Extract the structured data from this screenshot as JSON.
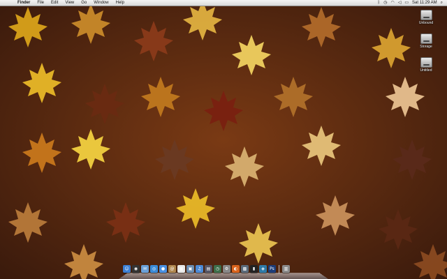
{
  "menubar": {
    "app_name": "Finder",
    "menus": [
      "File",
      "Edit",
      "View",
      "Go",
      "Window",
      "Help"
    ],
    "clock": "Sat 11:29 AM",
    "status_icons": [
      "bluetooth-icon",
      "time-machine-icon",
      "wifi-icon",
      "volume-icon",
      "battery-icon",
      "spotlight-icon"
    ]
  },
  "desktop": {
    "drives": [
      "Unbound",
      "Storage",
      "Untitled"
    ]
  },
  "dock": {
    "apps": [
      {
        "name": "finder-icon",
        "glyph": "☺",
        "color": "#3b7fd4"
      },
      {
        "name": "dashboard-icon",
        "glyph": "◉",
        "color": "#333"
      },
      {
        "name": "mail-icon",
        "glyph": "✉",
        "color": "#6aa0d8"
      },
      {
        "name": "safari-icon",
        "glyph": "◎",
        "color": "#3a8bd8"
      },
      {
        "name": "ichat-icon",
        "glyph": "●",
        "color": "#4a90e2"
      },
      {
        "name": "address-book-icon",
        "glyph": "@",
        "color": "#b08850"
      },
      {
        "name": "ical-icon",
        "glyph": "▦",
        "color": "#e8e8e8"
      },
      {
        "name": "preview-icon",
        "glyph": "▣",
        "color": "#6c8db0"
      },
      {
        "name": "itunes-icon",
        "glyph": "♫",
        "color": "#4c8ad6"
      },
      {
        "name": "spaces-icon",
        "glyph": "▤",
        "color": "#556"
      },
      {
        "name": "time-machine-icon",
        "glyph": "◷",
        "color": "#3d6e4a"
      },
      {
        "name": "system-preferences-icon",
        "glyph": "⚙",
        "color": "#888"
      },
      {
        "name": "firefox-icon",
        "glyph": "◐",
        "color": "#d9631c"
      },
      {
        "name": "mac-app-icon",
        "glyph": "▩",
        "color": "#5b6b7b"
      },
      {
        "name": "terminal-icon",
        "glyph": "▮",
        "color": "#222"
      },
      {
        "name": "network-icon",
        "glyph": "◈",
        "color": "#2e7aa8"
      },
      {
        "name": "photoshop-icon",
        "glyph": "Ps",
        "color": "#1c3c78"
      },
      {
        "name": "trash-icon",
        "glyph": "▥",
        "color": "#8a8a8a"
      }
    ]
  }
}
